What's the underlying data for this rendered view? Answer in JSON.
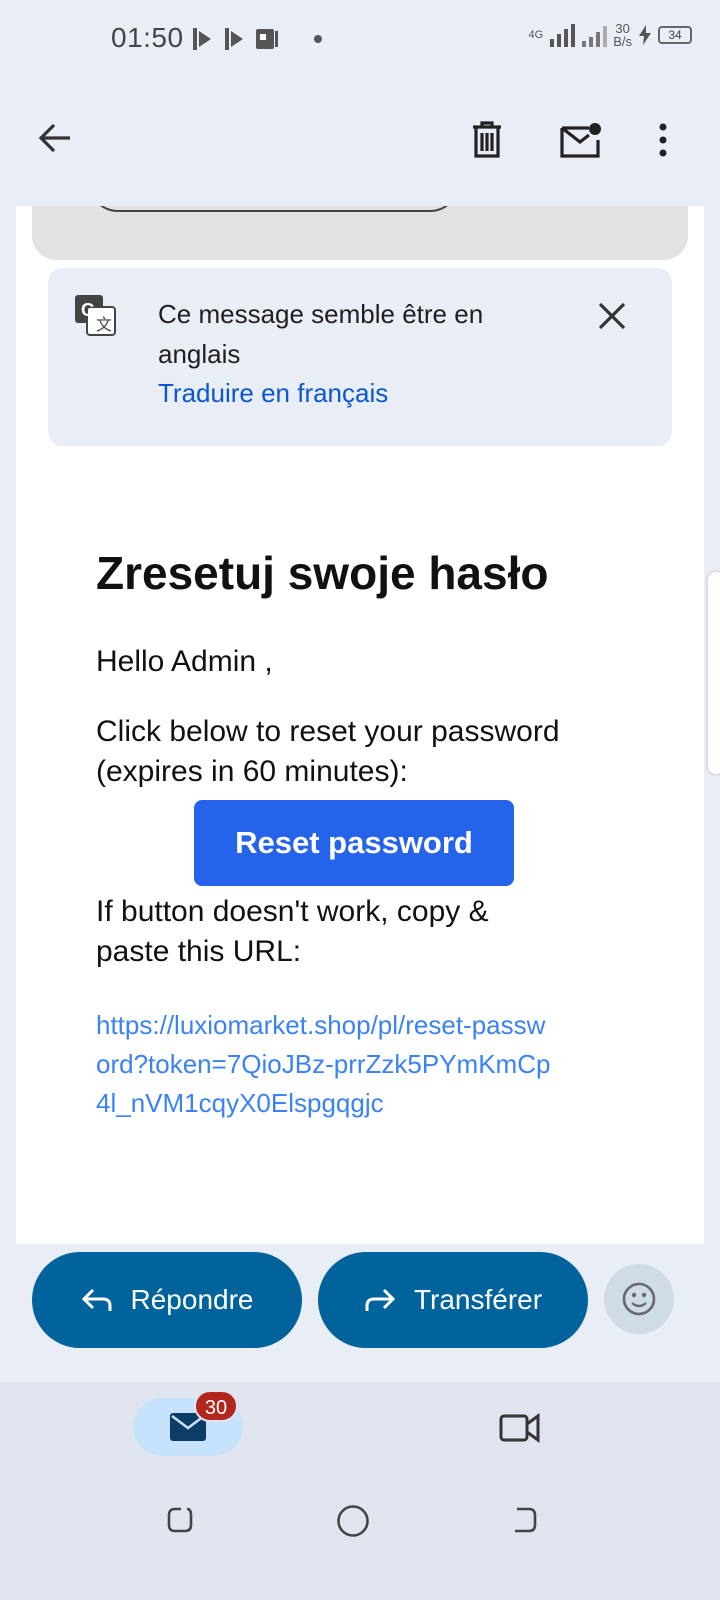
{
  "status_bar": {
    "time": "01:50",
    "network": "4G",
    "speed_value": "30",
    "speed_unit": "B/s",
    "battery": "34"
  },
  "app_bar": {
    "icons": [
      "back-arrow-icon",
      "trash-icon",
      "mark-unread-icon",
      "more-vert-icon"
    ]
  },
  "translate_banner": {
    "message": "Ce message semble être en anglais",
    "action": "Traduire en français"
  },
  "email": {
    "title": "Zresetuj swoje hasło",
    "greeting": "Hello Admin ,",
    "instruction": "Click below to reset your password (expires in 60 minutes):",
    "button_label": "Reset password",
    "fallback": "If button doesn't work, copy & paste this URL:",
    "url": "https://luxiomarket.shop/pl/reset-password?token=7QioJBz-prrZzk5PYmKmCp4l_nVM1cqyX0Elspgqgjc"
  },
  "actions": {
    "reply": "Répondre",
    "forward": "Transférer"
  },
  "bottom_nav": {
    "mail_badge": "30"
  },
  "colors": {
    "accent": "#00639b",
    "reset_button": "#2563eb",
    "link": "#0b57d0",
    "badge": "#b3261e"
  }
}
